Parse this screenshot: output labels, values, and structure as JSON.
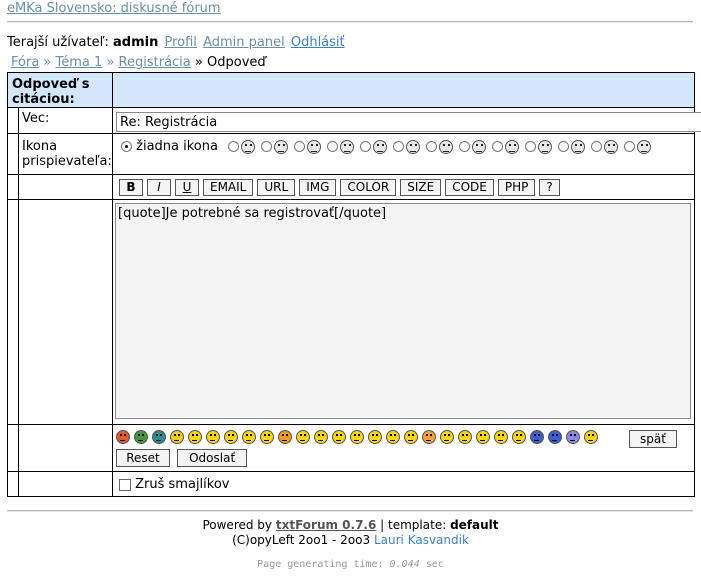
{
  "site": {
    "title": "eMKa Slovensko: diskusné fórum"
  },
  "user": {
    "label": "Terajší užívateľ:",
    "name": "admin",
    "links": [
      "Profil",
      "Admin panel",
      "Odhlásiť"
    ]
  },
  "breadcrumb": {
    "items": [
      "Fóra",
      "Téma 1",
      "Registrácia"
    ],
    "current": "Odpoveď",
    "separator": "»"
  },
  "form": {
    "header": "Odpoveď s citáciou:",
    "subject_label": "Vec:",
    "subject_value": "Re: Registrácia",
    "icon_label": "Ikona prispievateľa:",
    "icon_none": "žiadna ikona",
    "icon_count": 13,
    "toolbar": [
      "B",
      "I",
      "U",
      "EMAIL",
      "URL",
      "IMG",
      "COLOR",
      "SIZE",
      "CODE",
      "PHP",
      "?"
    ],
    "message_value": "[quote]Je potrebné sa registrovať[/quote]",
    "back_button": "späť",
    "reset_button": "Reset",
    "submit_button": "Odoslať",
    "disable_smilies_label": "Zruš smajlíkov"
  },
  "emoticon_colors": [
    "#e25a2a",
    "#3f9a3f",
    "#2d8f8f",
    "#f2cc1c",
    "#f6d41c",
    "#f6d41c",
    "#f6d41c",
    "#f6d41c",
    "#f6d41c",
    "#f29a1c",
    "#f6d41c",
    "#f6d41c",
    "#f6d41c",
    "#f6d41c",
    "#f6d41c",
    "#f6d41c",
    "#f6d41c",
    "#f2a23a",
    "#f6d41c",
    "#f6d41c",
    "#f6d41c",
    "#f6d41c",
    "#f6d41c",
    "#3a5fd0",
    "#3a5fd0",
    "#8a8ae0",
    "#f6d41c"
  ],
  "footer": {
    "powered": "Powered by",
    "product": "txtForum 0.7.6",
    "template_label": "| template:",
    "template": "default",
    "copyleft": "(C)opyLeft 2oo1 - 2oo3",
    "author": "Lauri Kasvandik",
    "gen_label": "Page generating time:",
    "gen_value": "0.044",
    "gen_unit": "sec"
  }
}
